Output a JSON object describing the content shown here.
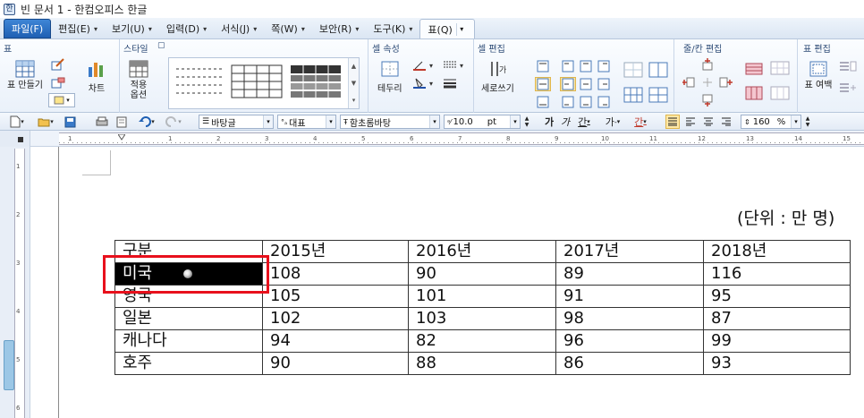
{
  "window": {
    "title": "빈 문서 1 - 한컴오피스 한글"
  },
  "menu": [
    {
      "label": "파일(F)",
      "dropdown": false
    },
    {
      "label": "편집(E)",
      "dropdown": true
    },
    {
      "label": "보기(U)",
      "dropdown": true
    },
    {
      "label": "입력(D)",
      "dropdown": true
    },
    {
      "label": "서식(J)",
      "dropdown": true
    },
    {
      "label": "쪽(W)",
      "dropdown": true
    },
    {
      "label": "보안(R)",
      "dropdown": true
    },
    {
      "label": "도구(K)",
      "dropdown": true
    },
    {
      "label": "표(Q)",
      "dropdown": false
    }
  ],
  "ribbon": {
    "groups": {
      "table": "표",
      "style": "스타일",
      "cell_props": "셀 속성",
      "cell_edit": "셀 편집",
      "rowcol_edit": "줄/칸 편집",
      "table_edit": "표 편집"
    },
    "buttons": {
      "make_table": "표 만들기",
      "chart": "차트",
      "apply_options": "적용 옵션",
      "border": "테두리",
      "vertical_writing": "세로쓰기",
      "margin": "표 여백"
    }
  },
  "toolbar": {
    "style_combo": "바탕글",
    "lang_combo": "대표",
    "font_combo": "함초롬바탕",
    "size_value": "10.0",
    "size_unit": "pt",
    "line_spacing": "160",
    "line_spacing_unit": "%"
  },
  "document": {
    "unit_text": "(단위 : 만 명)",
    "table": {
      "header": [
        "구분",
        "2015년",
        "2016년",
        "2017년",
        "2018년"
      ],
      "rows": [
        [
          "미국",
          "108",
          "90",
          "89",
          "116"
        ],
        [
          "영국",
          "105",
          "101",
          "91",
          "95"
        ],
        [
          "일본",
          "102",
          "103",
          "98",
          "87"
        ],
        [
          "캐나다",
          "94",
          "82",
          "96",
          "99"
        ],
        [
          "호주",
          "90",
          "88",
          "86",
          "93"
        ]
      ]
    }
  },
  "colors": {
    "accent": "#1e5fb3",
    "highlight_box": "#e8101c",
    "selection": "#000000"
  }
}
